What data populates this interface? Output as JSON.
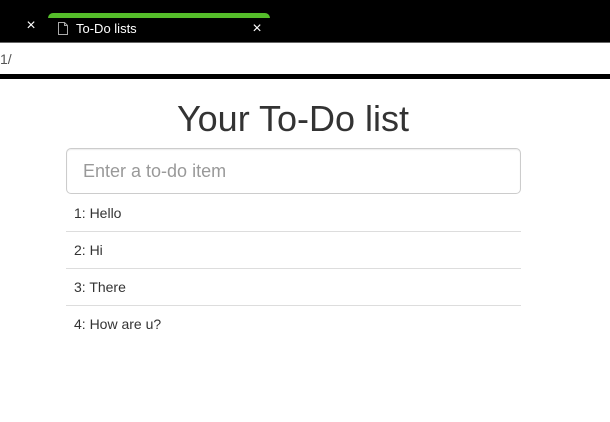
{
  "browser": {
    "prev_tab_close_icon": "close-icon",
    "active_tab": {
      "icon": "file-icon",
      "title": "To-Do lists",
      "close_icon": "close-icon",
      "accent_color": "#55bd2a"
    },
    "address_fragment": "1/"
  },
  "page": {
    "heading": "Your To-Do list",
    "new_item_placeholder": "Enter a to-do item",
    "new_item_value": "",
    "items": [
      "1: Hello",
      "2: Hi",
      "3: There",
      "4: How are u?"
    ]
  }
}
